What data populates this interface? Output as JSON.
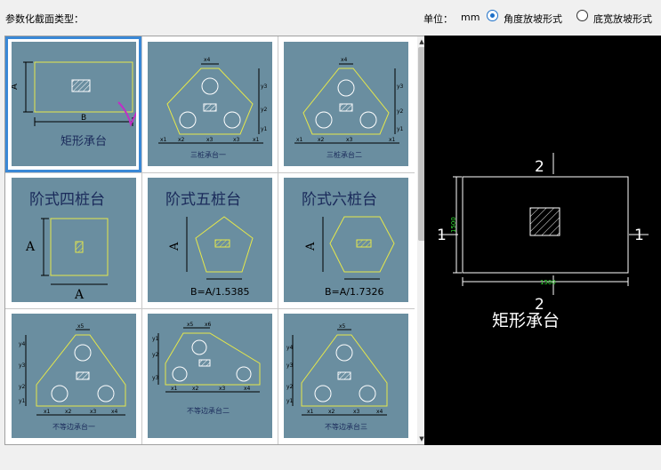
{
  "header": {
    "title": "参数化截面类型：",
    "unit_label": "单位：",
    "unit_value": "mm",
    "mode_options": [
      {
        "label": "角度放坡形式",
        "selected": true
      },
      {
        "label": "底宽放坡形式",
        "selected": false
      }
    ]
  },
  "gallery": {
    "items": [
      {
        "label": "矩形承台",
        "selected": true,
        "dims": [
          "A",
          "B"
        ]
      },
      {
        "label": "三桩承台一",
        "dims": [
          "x4",
          "y3",
          "y2",
          "y1",
          "x1",
          "x2",
          "x3",
          "x3",
          "x1"
        ]
      },
      {
        "label": "三桩承台二",
        "dims": [
          "x4",
          "y3",
          "y2",
          "y1",
          "x1",
          "x2",
          "x3",
          "x1"
        ]
      },
      {
        "label": "阶式四桩台",
        "dims": [
          "A",
          "A"
        ]
      },
      {
        "label": "阶式五桩台",
        "dims": [
          "A",
          "B=A/1.5385"
        ]
      },
      {
        "label": "阶式六桩台",
        "dims": [
          "A",
          "B=A/1.7326"
        ]
      },
      {
        "label": "不等边承台一",
        "dims": [
          "x5",
          "y4",
          "y3",
          "y2",
          "y1",
          "x1",
          "x2",
          "x3",
          "x4"
        ]
      },
      {
        "label": "不等边承台二",
        "dims": [
          "x5",
          "x6",
          "y1",
          "y2",
          "y3",
          "x1",
          "x2",
          "x3",
          "x4"
        ]
      },
      {
        "label": "不等边承台三",
        "dims": [
          "x5",
          "y4",
          "y3",
          "y2",
          "y1",
          "x1",
          "x2",
          "x3",
          "x4"
        ]
      }
    ]
  },
  "preview": {
    "title": "矩形承台",
    "section_marks": [
      "2",
      "1",
      "1",
      "2"
    ],
    "width_dim": "1500",
    "height_dim": "1500"
  },
  "colors": {
    "thumb_bg": "#6a8ea0",
    "shape_line": "#e6e84a",
    "selection": "#3a88d6",
    "checkmark": "#c02ec8",
    "preview_dim": "#33dd33"
  }
}
